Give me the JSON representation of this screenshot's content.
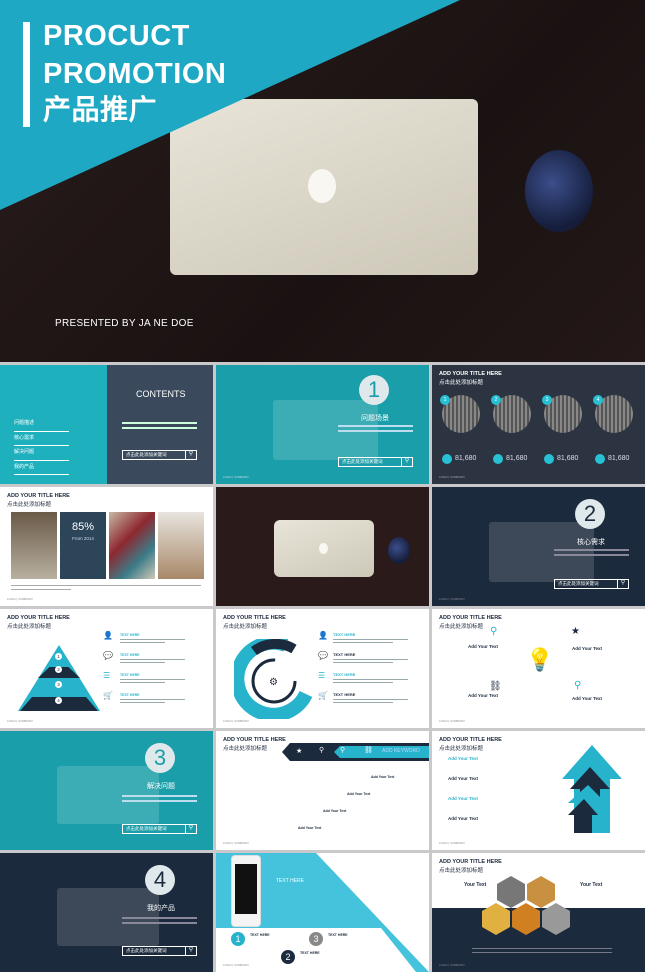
{
  "hero": {
    "title_line1": "PROCUCT",
    "title_line2": "PROMOTION",
    "title_cn": "产品推广",
    "presenter": "PRESENTED BY JA NE DOE"
  },
  "common": {
    "title_en": "ADD YOUR TITLE HERE",
    "title_cn": "点击此处添加标题",
    "search_placeholder": "点击此处添加关键词",
    "footer": "LOGO | COMPANY"
  },
  "contents": {
    "heading": "CONTENTS",
    "items": [
      "问题描述",
      "核心需求",
      "解决问题",
      "我的产品"
    ]
  },
  "sections": [
    {
      "num": "1",
      "title": "问题场景"
    },
    {
      "num": "2",
      "title": "核心需求"
    },
    {
      "num": "3",
      "title": "解决问题"
    },
    {
      "num": "4",
      "title": "我的产品"
    }
  ],
  "stats": {
    "badges": [
      "1",
      "2",
      "3",
      "4"
    ],
    "values": [
      "81,680",
      "81,680",
      "81,680",
      "81,680"
    ]
  },
  "gallery": {
    "percent": "85%",
    "since": "From 2014"
  },
  "pyramid": {
    "levels": [
      "1",
      "2",
      "3",
      "4"
    ],
    "labels": [
      "TEXT HERE",
      "TEXT HERE",
      "TEXT HERE",
      "TEXT HERE"
    ]
  },
  "donut": {
    "labels": [
      "TEXT HERE",
      "TEXT HERE",
      "TEXT HERE",
      "TEXT HERE"
    ]
  },
  "bulb": {
    "labels": [
      "Add Your Text",
      "Add Your Text",
      "Add Your Text",
      "Add Your Text"
    ]
  },
  "keyword": {
    "banner": "ADD KEYWORD",
    "labels": [
      "Add Your Text",
      "Add Your Text",
      "Add Your Text",
      "Add Your Text"
    ]
  },
  "arrows": {
    "labels": [
      "Add Your Text",
      "Add Your Text",
      "Add Your Text",
      "Add Your Text"
    ]
  },
  "phone": {
    "text_here": "TEXT HERE",
    "banner_cn": "点击此处添加标题",
    "banner_en": "TITLE HERE",
    "steps": [
      {
        "n": "1",
        "label": "TEXT HERE"
      },
      {
        "n": "2",
        "label": "TEXT HERE"
      },
      {
        "n": "3",
        "label": "TEXT HERE"
      }
    ]
  },
  "hex": {
    "left": "Your Text",
    "right": "Your Text"
  },
  "colors": {
    "teal": "#1ea8c3",
    "navy": "#1c2a3d",
    "slide_teal": "#1a9ea9",
    "accent": "#27b3cc"
  }
}
